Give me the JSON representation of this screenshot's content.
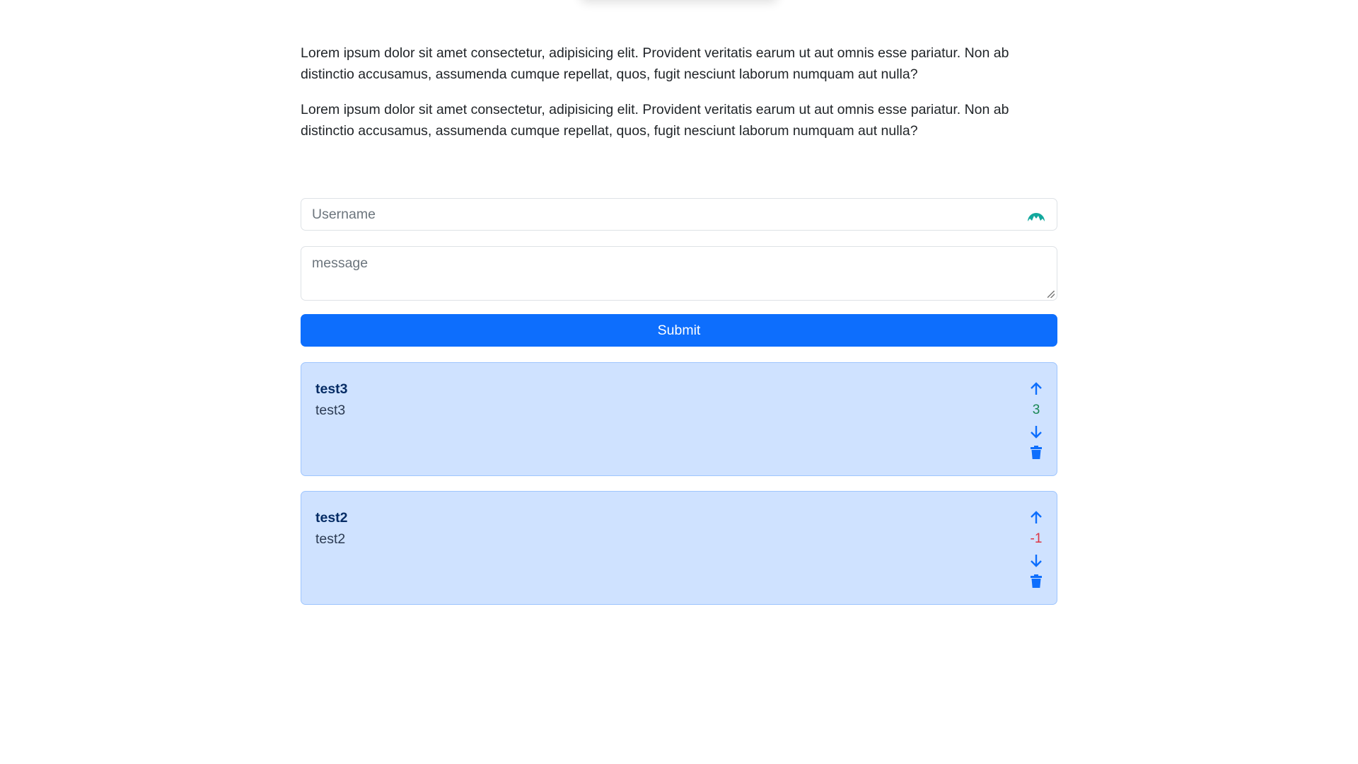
{
  "paragraphs": [
    "Lorem ipsum dolor sit amet consectetur, adipisicing elit. Provident veritatis earum ut aut omnis esse pariatur. Non ab distinctio accusamus, assumenda cumque repellat, quos, fugit nesciunt laborum numquam aut nulla?",
    "Lorem ipsum dolor sit amet consectetur, adipisicing elit. Provident veritatis earum ut aut omnis esse pariatur. Non ab distinctio accusamus, assumenda cumque repellat, quos, fugit nesciunt laborum numquam aut nulla?"
  ],
  "form": {
    "username_placeholder": "Username",
    "message_placeholder": "message",
    "submit_label": "Submit"
  },
  "posts": [
    {
      "title": "test3",
      "body": "test3",
      "score": "3",
      "score_color": "#198754"
    },
    {
      "title": "test2",
      "body": "test2",
      "score": "-1",
      "score_color": "#dc3545"
    }
  ],
  "colors": {
    "accent": "#0d6efd",
    "card_bg": "#cfe2ff"
  }
}
